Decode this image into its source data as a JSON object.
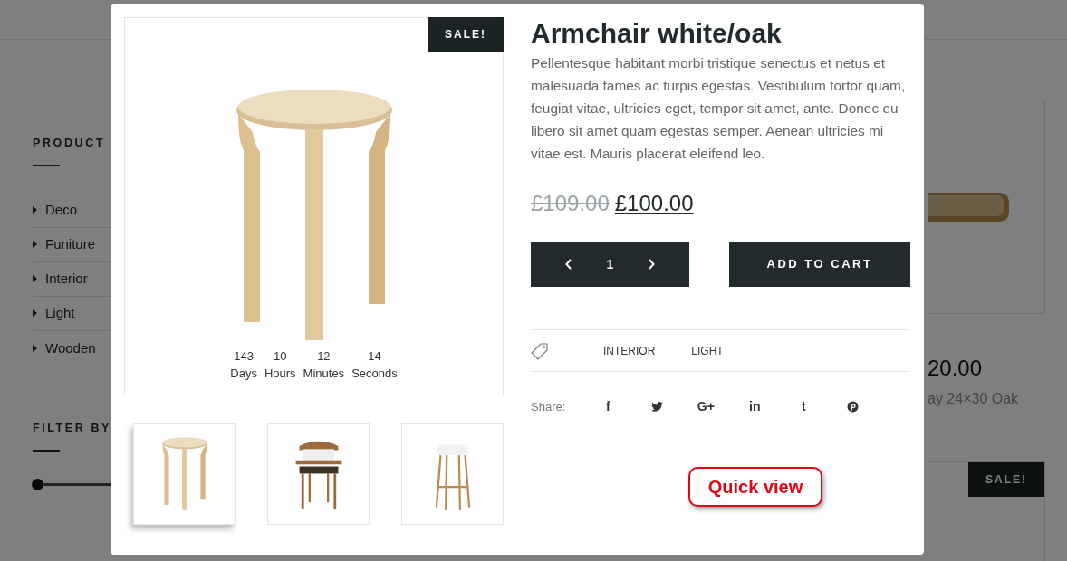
{
  "background": {
    "sidebar": {
      "heading": "PRODUCT",
      "categories": [
        "Deco",
        "Funiture",
        "Interior",
        "Light",
        "Wooden"
      ],
      "filter_heading": "FILTER BY",
      "price_slider": {
        "level": 0
      }
    },
    "products": [
      {
        "price": "20.00",
        "name": "ay 24×30 Oak"
      },
      {
        "badge": "SALE!"
      }
    ]
  },
  "quick_view": {
    "badge": "SALE!",
    "countdown": [
      {
        "value": "143",
        "unit": "Days"
      },
      {
        "value": "10",
        "unit": "Hours"
      },
      {
        "value": "12",
        "unit": "Minutes"
      },
      {
        "value": "14",
        "unit": "Seconds"
      }
    ],
    "thumbnails": [
      {
        "kind": "stool",
        "selected": true
      },
      {
        "kind": "armchair",
        "selected": false
      },
      {
        "kind": "barstool",
        "selected": false
      }
    ],
    "title": "Armchair white/oak",
    "description": "Pellentesque habitant morbi tristique senectus et netus et malesuada fames ac turpis egestas. Vestibulum tortor quam, feugiat vitae, ultricies eget, tempor sit amet, ante. Donec eu libero sit amet quam egestas semper. Aenean ultricies mi vitae est. Mauris placerat eleifend leo.",
    "old_price": "£109.00",
    "price": "£100.00",
    "quantity": "1",
    "add_to_cart": "ADD TO CART",
    "tags": [
      "INTERIOR",
      "LIGHT"
    ],
    "share_label": "Share:",
    "share_icons": [
      {
        "kind": "glyph",
        "text": "f"
      },
      {
        "kind": "bird"
      },
      {
        "kind": "glyph",
        "text": "G+"
      },
      {
        "kind": "glyph",
        "text": "in"
      },
      {
        "kind": "glyph",
        "text": "t"
      },
      {
        "kind": "pin"
      }
    ]
  },
  "callout": {
    "text": "Quick view"
  }
}
